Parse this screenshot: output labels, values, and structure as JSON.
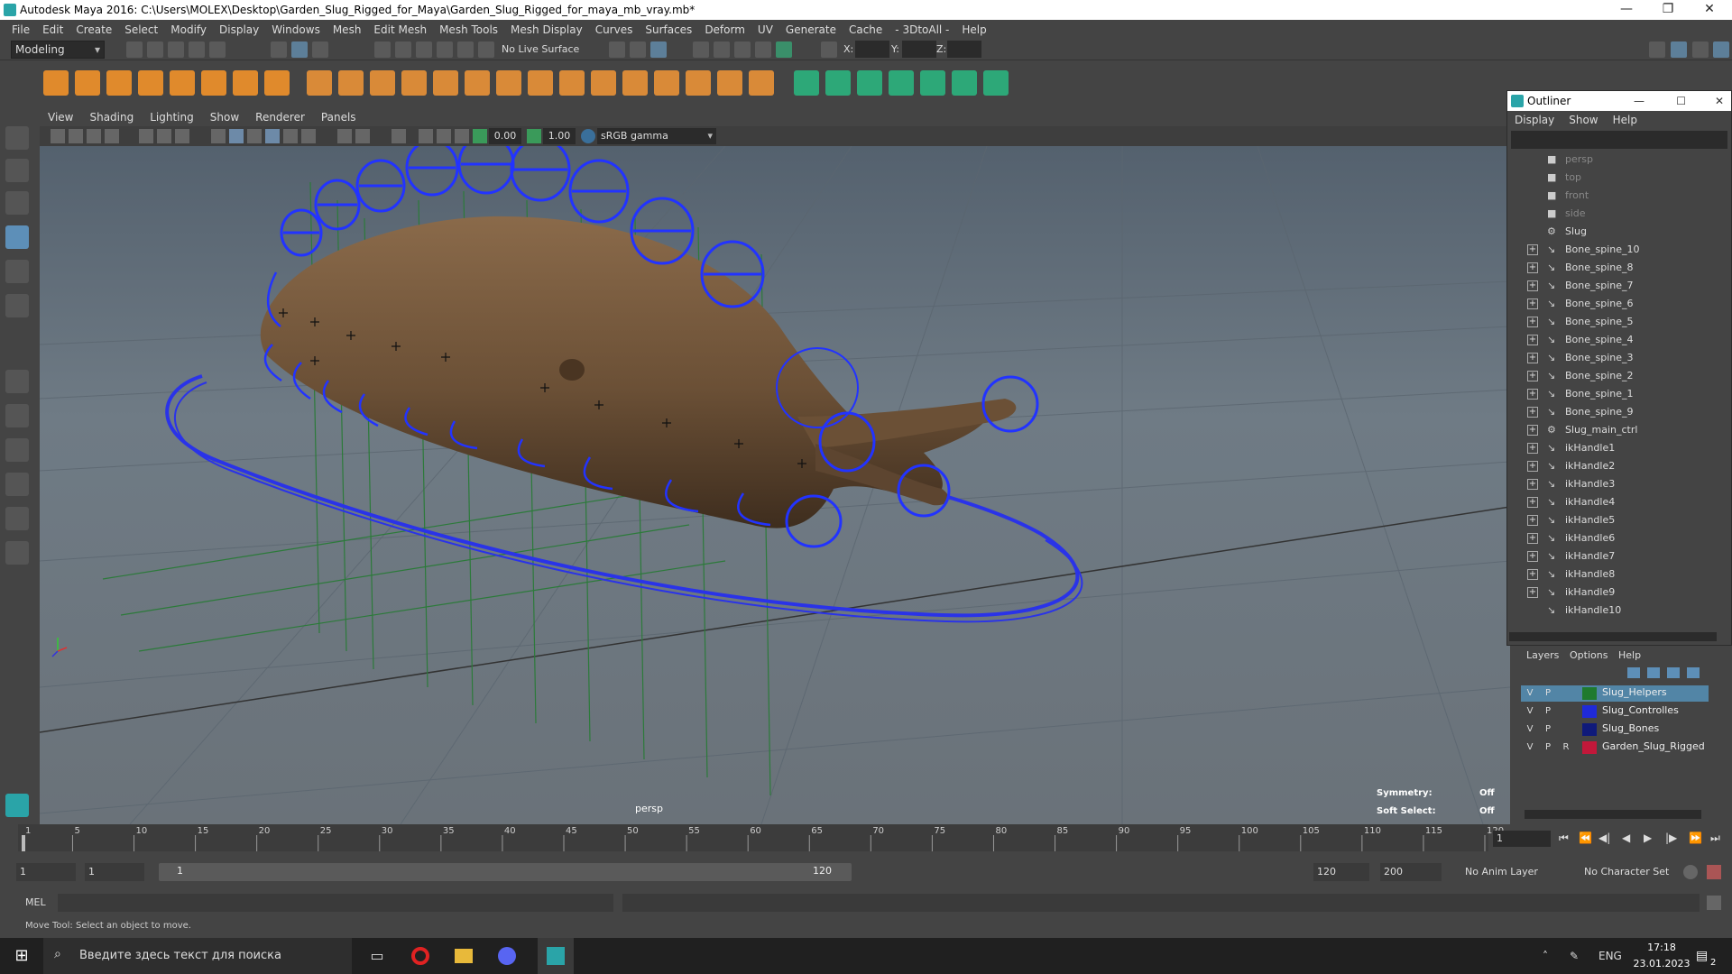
{
  "window": {
    "title": "Autodesk Maya 2016: C:\\Users\\MOLEX\\Desktop\\Garden_Slug_Rigged_for_Maya\\Garden_Slug_Rigged_for_maya_mb_vray.mb*",
    "min": "—",
    "max": "❐",
    "close": "✕"
  },
  "menu": [
    "File",
    "Edit",
    "Create",
    "Select",
    "Modify",
    "Display",
    "Windows",
    "Mesh",
    "Edit Mesh",
    "Mesh Tools",
    "Mesh Display",
    "Curves",
    "Surfaces",
    "Deform",
    "UV",
    "Generate",
    "Cache",
    "- 3DtoAll -",
    "Help"
  ],
  "status": {
    "mode": "Modeling",
    "live_surface": "No Live Surface",
    "x_label": "X:",
    "y_label": "Y:",
    "z_label": "Z:"
  },
  "viewport": {
    "menu": [
      "View",
      "Shading",
      "Lighting",
      "Show",
      "Renderer",
      "Panels"
    ],
    "field1": "0.00",
    "field2": "1.00",
    "color_space": "sRGB gamma",
    "camera": "persp",
    "symmetry_label": "Symmetry:",
    "symmetry_value": "Off",
    "soft_select_label": "Soft Select:",
    "soft_select_value": "Off"
  },
  "outliner": {
    "title": "Outliner",
    "menu": [
      "Display",
      "Show",
      "Help"
    ],
    "items": [
      {
        "label": "persp",
        "dim": true,
        "expand": false,
        "icon": "camera-icon"
      },
      {
        "label": "top",
        "dim": true,
        "expand": false,
        "icon": "camera-icon"
      },
      {
        "label": "front",
        "dim": true,
        "expand": false,
        "icon": "camera-icon"
      },
      {
        "label": "side",
        "dim": true,
        "expand": false,
        "icon": "camera-icon"
      },
      {
        "label": "Slug",
        "dim": false,
        "expand": false,
        "icon": "transform-icon"
      },
      {
        "label": "Bone_spine_10",
        "dim": false,
        "expand": true,
        "icon": "joint-icon"
      },
      {
        "label": "Bone_spine_8",
        "dim": false,
        "expand": true,
        "icon": "joint-icon"
      },
      {
        "label": "Bone_spine_7",
        "dim": false,
        "expand": true,
        "icon": "joint-icon"
      },
      {
        "label": "Bone_spine_6",
        "dim": false,
        "expand": true,
        "icon": "joint-icon"
      },
      {
        "label": "Bone_spine_5",
        "dim": false,
        "expand": true,
        "icon": "joint-icon"
      },
      {
        "label": "Bone_spine_4",
        "dim": false,
        "expand": true,
        "icon": "joint-icon"
      },
      {
        "label": "Bone_spine_3",
        "dim": false,
        "expand": true,
        "icon": "joint-icon"
      },
      {
        "label": "Bone_spine_2",
        "dim": false,
        "expand": true,
        "icon": "joint-icon"
      },
      {
        "label": "Bone_spine_1",
        "dim": false,
        "expand": true,
        "icon": "joint-icon"
      },
      {
        "label": "Bone_spine_9",
        "dim": false,
        "expand": true,
        "icon": "joint-icon"
      },
      {
        "label": "Slug_main_ctrl",
        "dim": false,
        "expand": true,
        "icon": "transform-icon"
      },
      {
        "label": "ikHandle1",
        "dim": false,
        "expand": true,
        "icon": "ik-icon"
      },
      {
        "label": "ikHandle2",
        "dim": false,
        "expand": true,
        "icon": "ik-icon"
      },
      {
        "label": "ikHandle3",
        "dim": false,
        "expand": true,
        "icon": "ik-icon"
      },
      {
        "label": "ikHandle4",
        "dim": false,
        "expand": true,
        "icon": "ik-icon"
      },
      {
        "label": "ikHandle5",
        "dim": false,
        "expand": true,
        "icon": "ik-icon"
      },
      {
        "label": "ikHandle6",
        "dim": false,
        "expand": true,
        "icon": "ik-icon"
      },
      {
        "label": "ikHandle7",
        "dim": false,
        "expand": true,
        "icon": "ik-icon"
      },
      {
        "label": "ikHandle8",
        "dim": false,
        "expand": true,
        "icon": "ik-icon"
      },
      {
        "label": "ikHandle9",
        "dim": false,
        "expand": true,
        "icon": "ik-icon"
      },
      {
        "label": "ikHandle10",
        "dim": false,
        "expand": false,
        "icon": "ik-icon"
      }
    ]
  },
  "layers": {
    "menu": [
      "Layers",
      "Options",
      "Help"
    ],
    "rows": [
      {
        "v": "V",
        "p": "P",
        "r": "",
        "color": "#1f7a2e",
        "name": "Slug_Helpers",
        "selected": true
      },
      {
        "v": "V",
        "p": "P",
        "r": "",
        "color": "#1f2ad8",
        "name": "Slug_Controlles",
        "selected": false
      },
      {
        "v": "V",
        "p": "P",
        "r": "",
        "color": "#0f1a7a",
        "name": "Slug_Bones",
        "selected": false
      },
      {
        "v": "V",
        "p": "P",
        "r": "R",
        "color": "#c2183a",
        "name": "Garden_Slug_Rigged",
        "selected": false
      }
    ]
  },
  "timeline": {
    "ticks": [
      "1",
      "5",
      "10",
      "15",
      "20",
      "25",
      "30",
      "35",
      "40",
      "45",
      "50",
      "55",
      "60",
      "65",
      "70",
      "75",
      "80",
      "85",
      "90",
      "95",
      "100",
      "105",
      "110",
      "115",
      "120"
    ],
    "current_frame": "1"
  },
  "range": {
    "start": "1",
    "playback_start": "1",
    "slider_start": "1",
    "slider_end": "120",
    "playback_end": "120",
    "end": "200",
    "anim_layer": "No Anim Layer",
    "character_set": "No Character Set"
  },
  "cmd": {
    "label": "MEL"
  },
  "help": {
    "text": "Move Tool: Select an object to move."
  },
  "taskbar": {
    "search_placeholder": "Введите здесь текст для поиска",
    "lang": "ENG",
    "time": "17:18",
    "date": "23.01.2023",
    "notif_count": "2"
  }
}
